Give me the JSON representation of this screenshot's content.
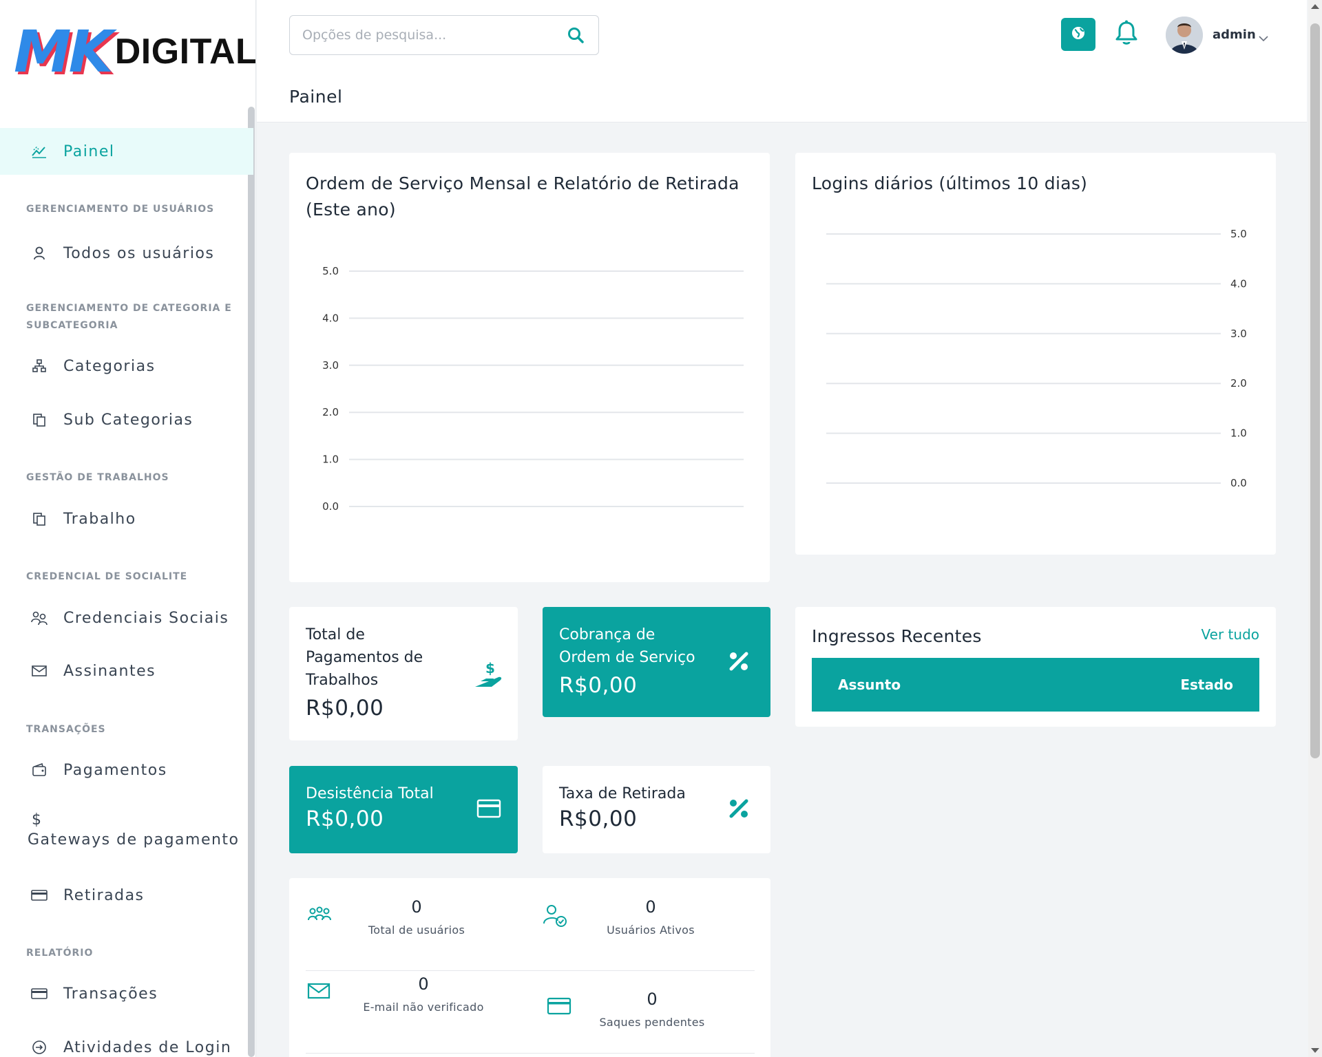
{
  "brand": {
    "mk": "MK",
    "digital": "DIGITAL"
  },
  "search": {
    "placeholder": "Opções de pesquisa..."
  },
  "user": {
    "name": "admin"
  },
  "page_title": "Painel",
  "sidebar": {
    "active": {
      "label": "Painel",
      "icon": "chart-line-icon"
    },
    "sections": [
      {
        "title": "GERENCIAMENTO DE USUÁRIOS",
        "items": [
          {
            "label": "Todos os usuários",
            "icon": "user-icon"
          }
        ]
      },
      {
        "title": "GERENCIAMENTO DE CATEGORIA E SUBCATEGORIA",
        "items": [
          {
            "label": "Categorias",
            "icon": "sitemap-icon"
          },
          {
            "label": "Sub Categorias",
            "icon": "copy-icon"
          }
        ]
      },
      {
        "title": "GESTÃO DE TRABALHOS",
        "items": [
          {
            "label": "Trabalho",
            "icon": "copy-icon"
          }
        ]
      },
      {
        "title": "CREDENCIAL DE SOCIALITE",
        "items": [
          {
            "label": "Credenciais Sociais",
            "icon": "users-icon"
          },
          {
            "label": "Assinantes",
            "icon": "envelope-icon"
          }
        ]
      },
      {
        "title": "TRANSAÇÕES",
        "items": [
          {
            "label": "Pagamentos",
            "icon": "wallet-icon"
          },
          {
            "label": "Gateways de pagamento",
            "icon": "dollar-icon"
          },
          {
            "label": "Retiradas",
            "icon": "credit-card-icon"
          }
        ]
      },
      {
        "title": "RELATÓRIO",
        "items": [
          {
            "label": "Transações",
            "icon": "credit-card-icon"
          },
          {
            "label": "Atividades de Login",
            "icon": "sign-in-icon"
          }
        ]
      }
    ]
  },
  "chart_monthly": {
    "title": "Ordem de Serviço Mensal e Relatório de Retirada (Este ano)"
  },
  "chart_logins": {
    "title": "Logins diários (últimos 10 dias)"
  },
  "chart_data": [
    {
      "type": "line",
      "title": "Ordem de Serviço Mensal e Relatório de Retirada (Este ano)",
      "y_ticks": [
        "0.0",
        "1.0",
        "2.0",
        "3.0",
        "4.0",
        "5.0"
      ],
      "ylim": [
        0,
        5
      ],
      "series": [],
      "grid": true,
      "y_axis_side": "left"
    },
    {
      "type": "line",
      "title": "Logins diários (últimos 10 dias)",
      "y_ticks": [
        "0.0",
        "1.0",
        "2.0",
        "3.0",
        "4.0",
        "5.0"
      ],
      "ylim": [
        0,
        5
      ],
      "series": [],
      "grid": true,
      "y_axis_side": "right"
    }
  ],
  "stats": {
    "pagamentos": {
      "label": "Total de Pagamentos de Trabalhos",
      "value": "R$0,00",
      "icon": "hand-holding-dollar-icon"
    },
    "cobranca": {
      "label": "Cobrança de Ordem de Serviço",
      "value": "R$0,00",
      "icon": "percent-icon"
    },
    "desistencia": {
      "label": "Desistência Total",
      "value": "R$0,00",
      "icon": "credit-card-icon"
    },
    "taxa": {
      "label": "Taxa de Retirada",
      "value": "R$0,00",
      "icon": "percent-icon"
    }
  },
  "ingressos": {
    "title": "Ingressos Recentes",
    "link": "Ver tudo",
    "columns": [
      "Assunto",
      "Estado"
    ]
  },
  "user_stats": [
    {
      "value": "0",
      "label": "Total de usuários",
      "icon": "users-group-icon"
    },
    {
      "value": "0",
      "label": "Usuários Ativos",
      "icon": "user-check-icon"
    },
    {
      "value": "0",
      "label": "E-mail não verificado",
      "icon": "envelope-icon"
    },
    {
      "value": "0",
      "label": "Saques pendentes",
      "icon": "credit-card-icon"
    }
  ],
  "colors": {
    "accent": "#0aa39f",
    "active_bg": "#e8fbfa"
  }
}
